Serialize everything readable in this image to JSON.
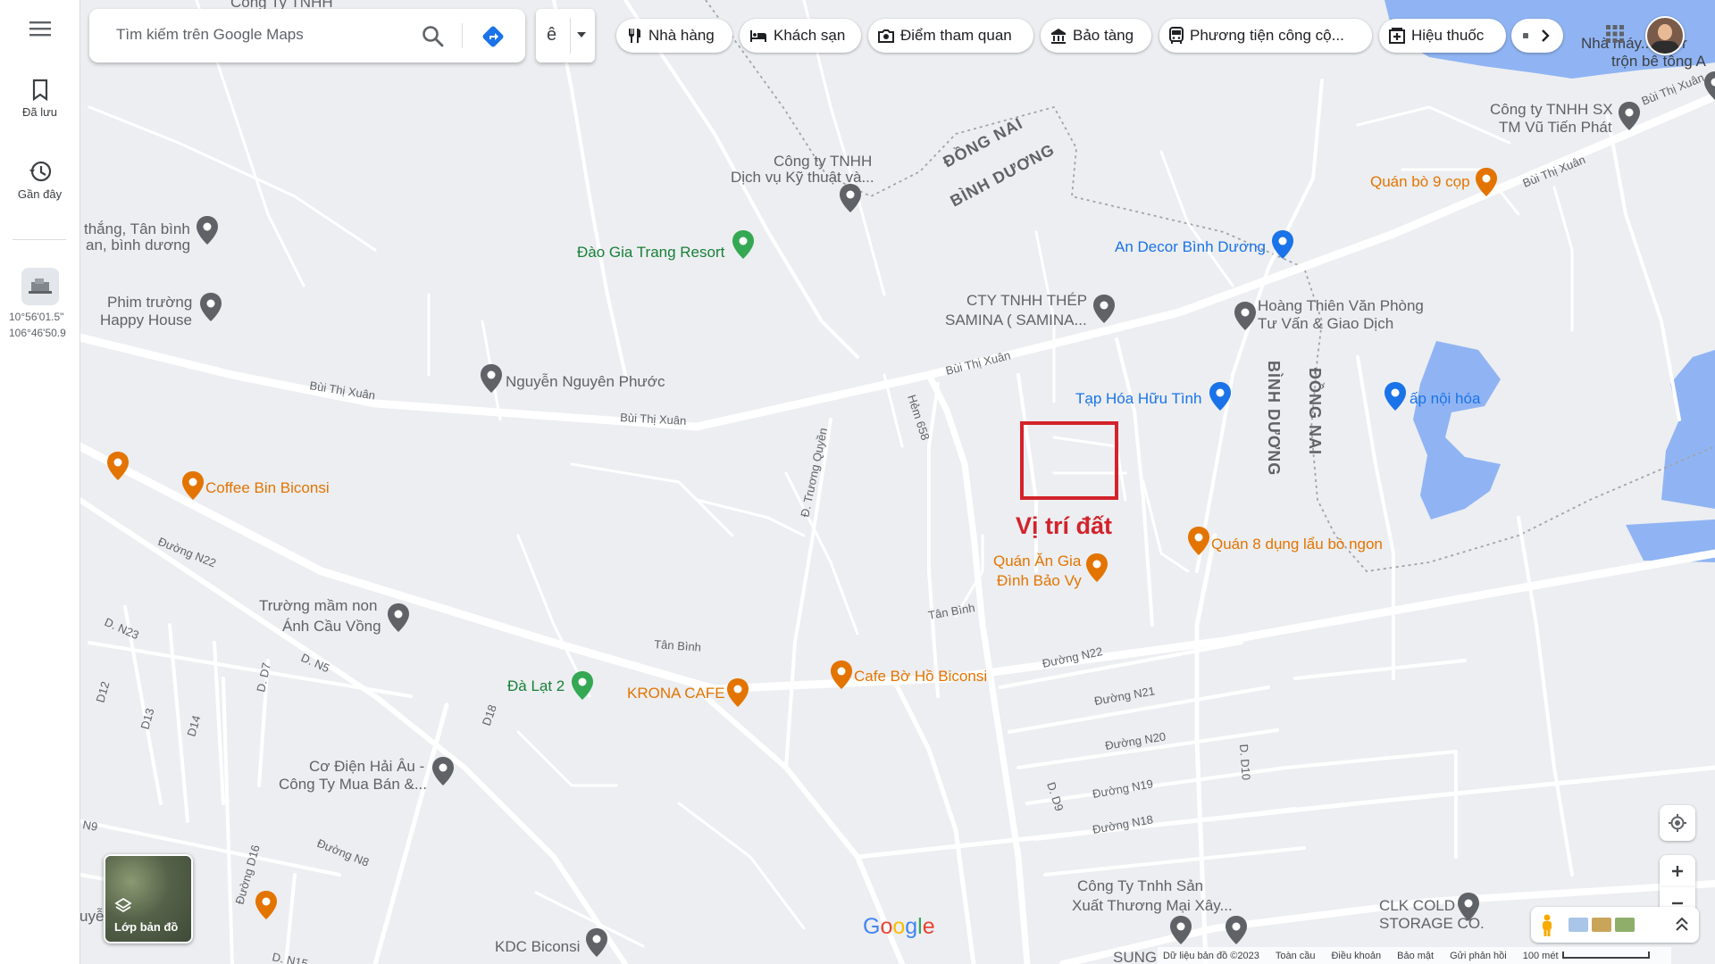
{
  "sidebar": {
    "saved_label": "Đã lưu",
    "recent_label": "Gần đây",
    "coord_lat": "10°56'01.5\"",
    "coord_lng": "106°46'50.9"
  },
  "search": {
    "placeholder": "Tìm kiếm trên Google Maps",
    "input_method": "ê"
  },
  "chips": [
    {
      "label": "Nhà hàng",
      "icon": "restaurant-icon"
    },
    {
      "label": "Khách sạn",
      "icon": "hotel-icon"
    },
    {
      "label": "Điểm tham quan",
      "icon": "camera-icon"
    },
    {
      "label": "Bảo tàng",
      "icon": "museum-icon"
    },
    {
      "label": "Phương tiện công cộ...",
      "icon": "transit-icon"
    },
    {
      "label": "Hiệu thuốc",
      "icon": "pharmacy-icon"
    }
  ],
  "map": {
    "marker_label": "Vị trí đất",
    "layers_label": "Lớp bản đồ",
    "google_logo": "Google",
    "provinces": [
      "ĐỒNG NAI",
      "BÌNH DƯƠNG",
      "BÌNH DƯƠNG",
      "ĐỒNG NAI"
    ],
    "roads": [
      "Bùi Thị Xuân",
      "Bùi Thị Xuân",
      "Bùi Thị Xuân",
      "Bùi Thị Xuân",
      "Bùi Thị Xuân",
      "Đ. Trương Quyền",
      "Hẻm 658",
      "Tân Bình",
      "Tân Bình",
      "Đường N22",
      "Đường N22",
      "Đường N21",
      "Đường N20",
      "Đường N19",
      "Đường N18",
      "D. N23",
      "D. N5",
      "D. D7",
      "D12",
      "D13",
      "D14",
      "D18",
      "N9",
      "Đường N8",
      "Đường D16",
      "D. D9",
      "D. D10",
      "D. N15"
    ],
    "places": [
      {
        "name": "Công Ty TNHH",
        "color": "#5f6368"
      },
      {
        "name": "Công ty TNHH",
        "color": "#5f6368"
      },
      {
        "name": "Dịch vụ Kỹ thuật và...",
        "color": "#5f6368"
      },
      {
        "name": "Đào Gia Trang Resort",
        "color": "#188038"
      },
      {
        "name": "thắng, Tân bình",
        "color": "#5f6368"
      },
      {
        "name": "an, bình dương",
        "color": "#5f6368"
      },
      {
        "name": "Phim trường",
        "color": "#5f6368"
      },
      {
        "name": "Happy House",
        "color": "#5f6368"
      },
      {
        "name": "Nguyễn Nguyên Phước",
        "color": "#5f6368"
      },
      {
        "name": "CTY TNHH THÉP",
        "color": "#5f6368"
      },
      {
        "name": "SAMINA ( SAMINA...",
        "color": "#5f6368"
      },
      {
        "name": "An Decor Bình Dương",
        "color": "#1a73e8"
      },
      {
        "name": "Hoàng Thiên Văn Phòng",
        "color": "#5f6368"
      },
      {
        "name": "Tư Vấn & Giao Dịch",
        "color": "#5f6368"
      },
      {
        "name": "Công ty TNHH SX",
        "color": "#5f6368"
      },
      {
        "name": "TM Vũ Tiến Phát",
        "color": "#5f6368"
      },
      {
        "name": "Quán bò 9 cọp",
        "color": "#e37400"
      },
      {
        "name": "Nhà máy... bị Tr",
        "color": "#5f6368"
      },
      {
        "name": "trộn bê tông A",
        "color": "#5f6368"
      },
      {
        "name": "Tạp Hóa Hữu Tình",
        "color": "#1a73e8"
      },
      {
        "name": "ấp nội hóa",
        "color": "#1a73e8"
      },
      {
        "name": "Coffee Bin Biconsi",
        "color": "#e37400"
      },
      {
        "name": "Quán 8 dụng lẩu bò ngon",
        "color": "#e37400"
      },
      {
        "name": "Quán Ăn Gia",
        "color": "#e37400"
      },
      {
        "name": "Đình Bảo Vy",
        "color": "#e37400"
      },
      {
        "name": "Trường mầm non",
        "color": "#5f6368"
      },
      {
        "name": "Ánh Cầu Vồng",
        "color": "#5f6368"
      },
      {
        "name": "Đà Lạt 2",
        "color": "#188038"
      },
      {
        "name": "KRONA CAFE",
        "color": "#e37400"
      },
      {
        "name": "Cafe Bờ Hồ Biconsi",
        "color": "#e37400"
      },
      {
        "name": "Cơ Điện Hải Âu -",
        "color": "#5f6368"
      },
      {
        "name": "Công Ty Mua Bán &...",
        "color": "#5f6368"
      },
      {
        "name": "Công Ty Tnhh Sản",
        "color": "#5f6368"
      },
      {
        "name": "Xuất Thương Mại Xây...",
        "color": "#5f6368"
      },
      {
        "name": "CLK COLD",
        "color": "#5f6368"
      },
      {
        "name": "STORAGE CO.",
        "color": "#5f6368"
      },
      {
        "name": "KDC Biconsi",
        "color": "#5f6368"
      },
      {
        "name": "uyễn",
        "color": "#5f6368"
      },
      {
        "name": "SUNG",
        "color": "#5f6368"
      }
    ]
  },
  "footer": {
    "data": "Dữ liệu bản đồ ©2023",
    "global": "Toàn cầu",
    "terms": "Điều khoản",
    "privacy": "Bảo mật",
    "feedback": "Gửi phản hồi",
    "scale": "100 mét"
  },
  "colors": {
    "marker": "#d3232b",
    "water": "#90b4f3",
    "road": "#ffffff",
    "land": "#eceef1"
  }
}
